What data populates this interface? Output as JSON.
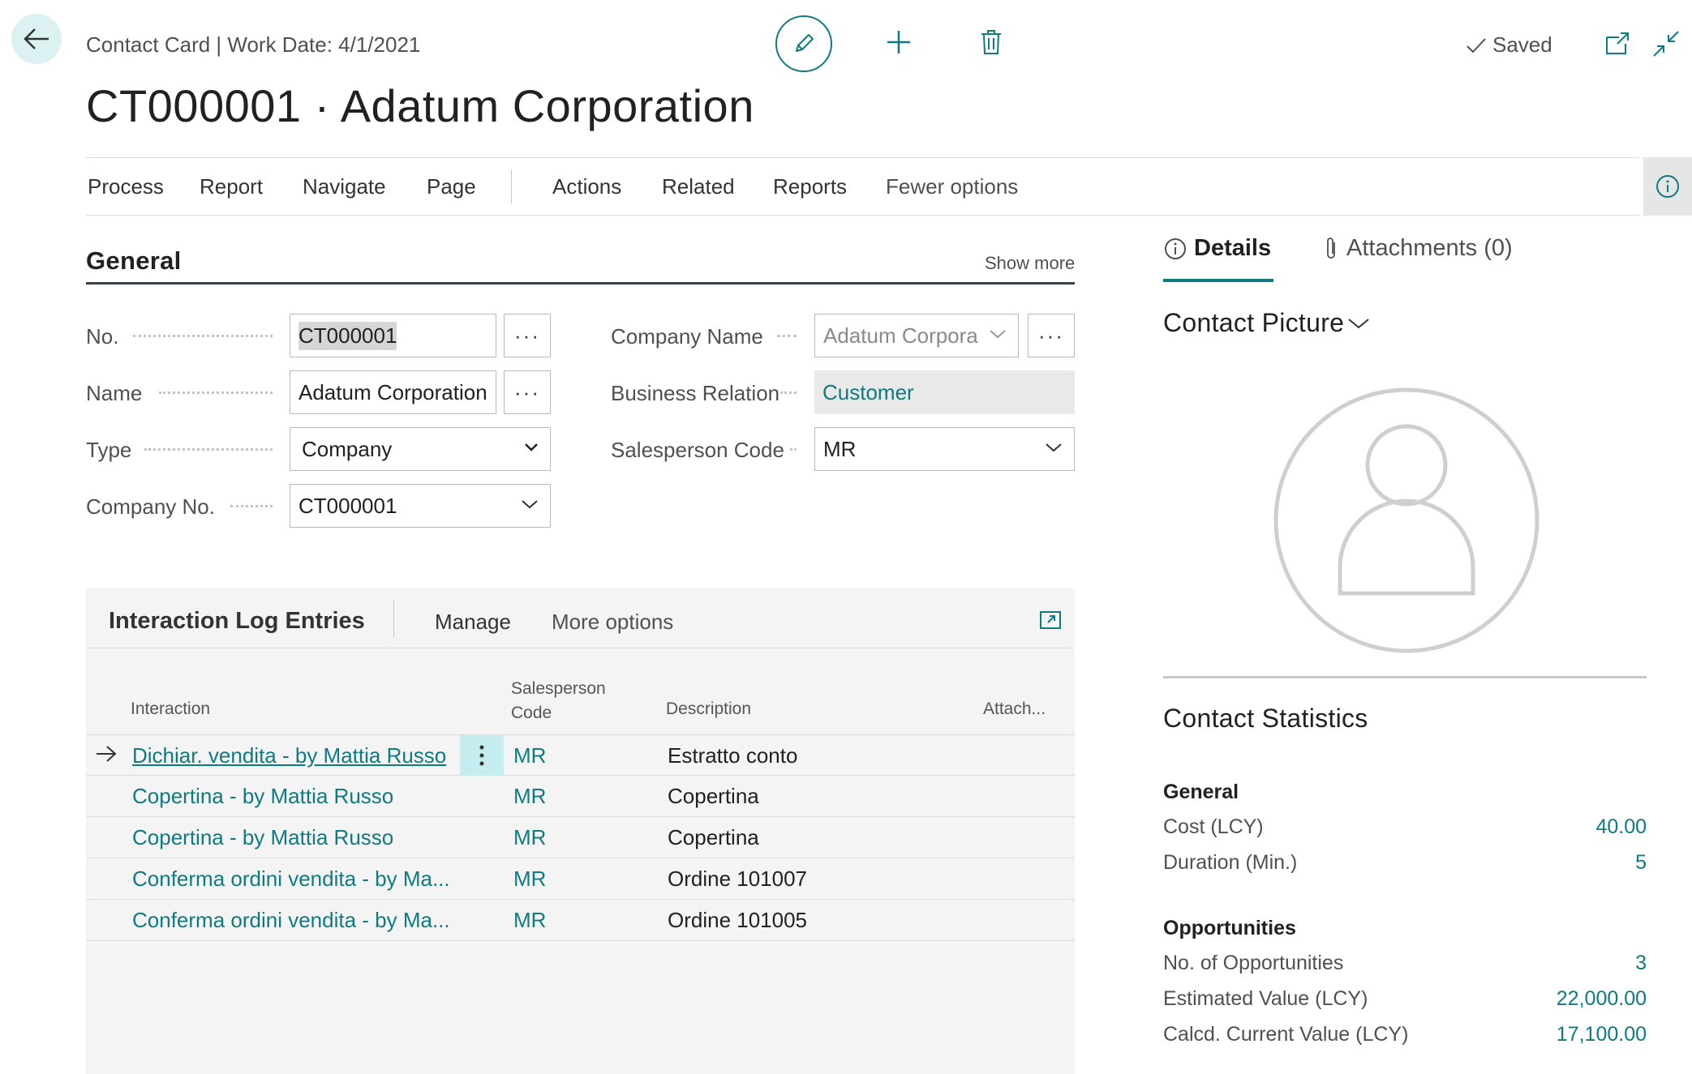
{
  "header": {
    "breadcrumb": "Contact Card | Work Date: 4/1/2021",
    "title": "CT000001 · Adatum Corporation",
    "saved_label": "Saved"
  },
  "actionbar": {
    "items": [
      "Process",
      "Report",
      "Navigate",
      "Page",
      "Actions",
      "Related",
      "Reports",
      "Fewer options"
    ]
  },
  "general": {
    "title": "General",
    "show_more": "Show more",
    "fields": {
      "no": {
        "label": "No.",
        "value": "CT000001"
      },
      "name": {
        "label": "Name",
        "value": "Adatum Corporation"
      },
      "type": {
        "label": "Type",
        "value": "Company"
      },
      "company_no": {
        "label": "Company No.",
        "value": "CT000001"
      },
      "company_name": {
        "label": "Company Name",
        "value": "Adatum Corpora"
      },
      "business_relation": {
        "label": "Business Relation",
        "value": "Customer"
      },
      "salesperson_code": {
        "label": "Salesperson Code",
        "value": "MR"
      }
    }
  },
  "interaction_log": {
    "title": "Interaction Log Entries",
    "actions": [
      "Manage",
      "More options"
    ],
    "columns": {
      "interaction": "Interaction",
      "salesperson_1": "Salesperson",
      "salesperson_2": "Code",
      "description": "Description",
      "attach": "Attach..."
    },
    "rows": [
      {
        "interaction": "Dichiar. vendita - by Mattia Russo",
        "salesperson": "MR",
        "description": "Estratto conto"
      },
      {
        "interaction": "Copertina - by Mattia Russo",
        "salesperson": "MR",
        "description": "Copertina"
      },
      {
        "interaction": "Copertina - by Mattia Russo",
        "salesperson": "MR",
        "description": "Copertina"
      },
      {
        "interaction": "Conferma ordini vendita - by Ma...",
        "salesperson": "MR",
        "description": "Ordine 101007"
      },
      {
        "interaction": "Conferma ordini vendita - by Ma...",
        "salesperson": "MR",
        "description": "Ordine 101005"
      }
    ]
  },
  "factbox": {
    "tabs": {
      "details": "Details",
      "attachments": "Attachments (0)"
    },
    "contact_picture": "Contact Picture",
    "contact_statistics": "Contact Statistics",
    "general_group": "General",
    "cost_label": "Cost (LCY)",
    "cost_value": "40.00",
    "duration_label": "Duration (Min.)",
    "duration_value": "5",
    "opportunities_group": "Opportunities",
    "no_opps_label": "No. of Opportunities",
    "no_opps_value": "3",
    "est_value_label": "Estimated Value (LCY)",
    "est_value_value": "22,000.00",
    "calc_value_label": "Calcd. Current Value (LCY)",
    "calc_value_value": "17,100.00"
  },
  "colors": {
    "accent": "#0f7a80",
    "row_menu": "#c5ecef",
    "back_button": "#dcf1f2"
  }
}
